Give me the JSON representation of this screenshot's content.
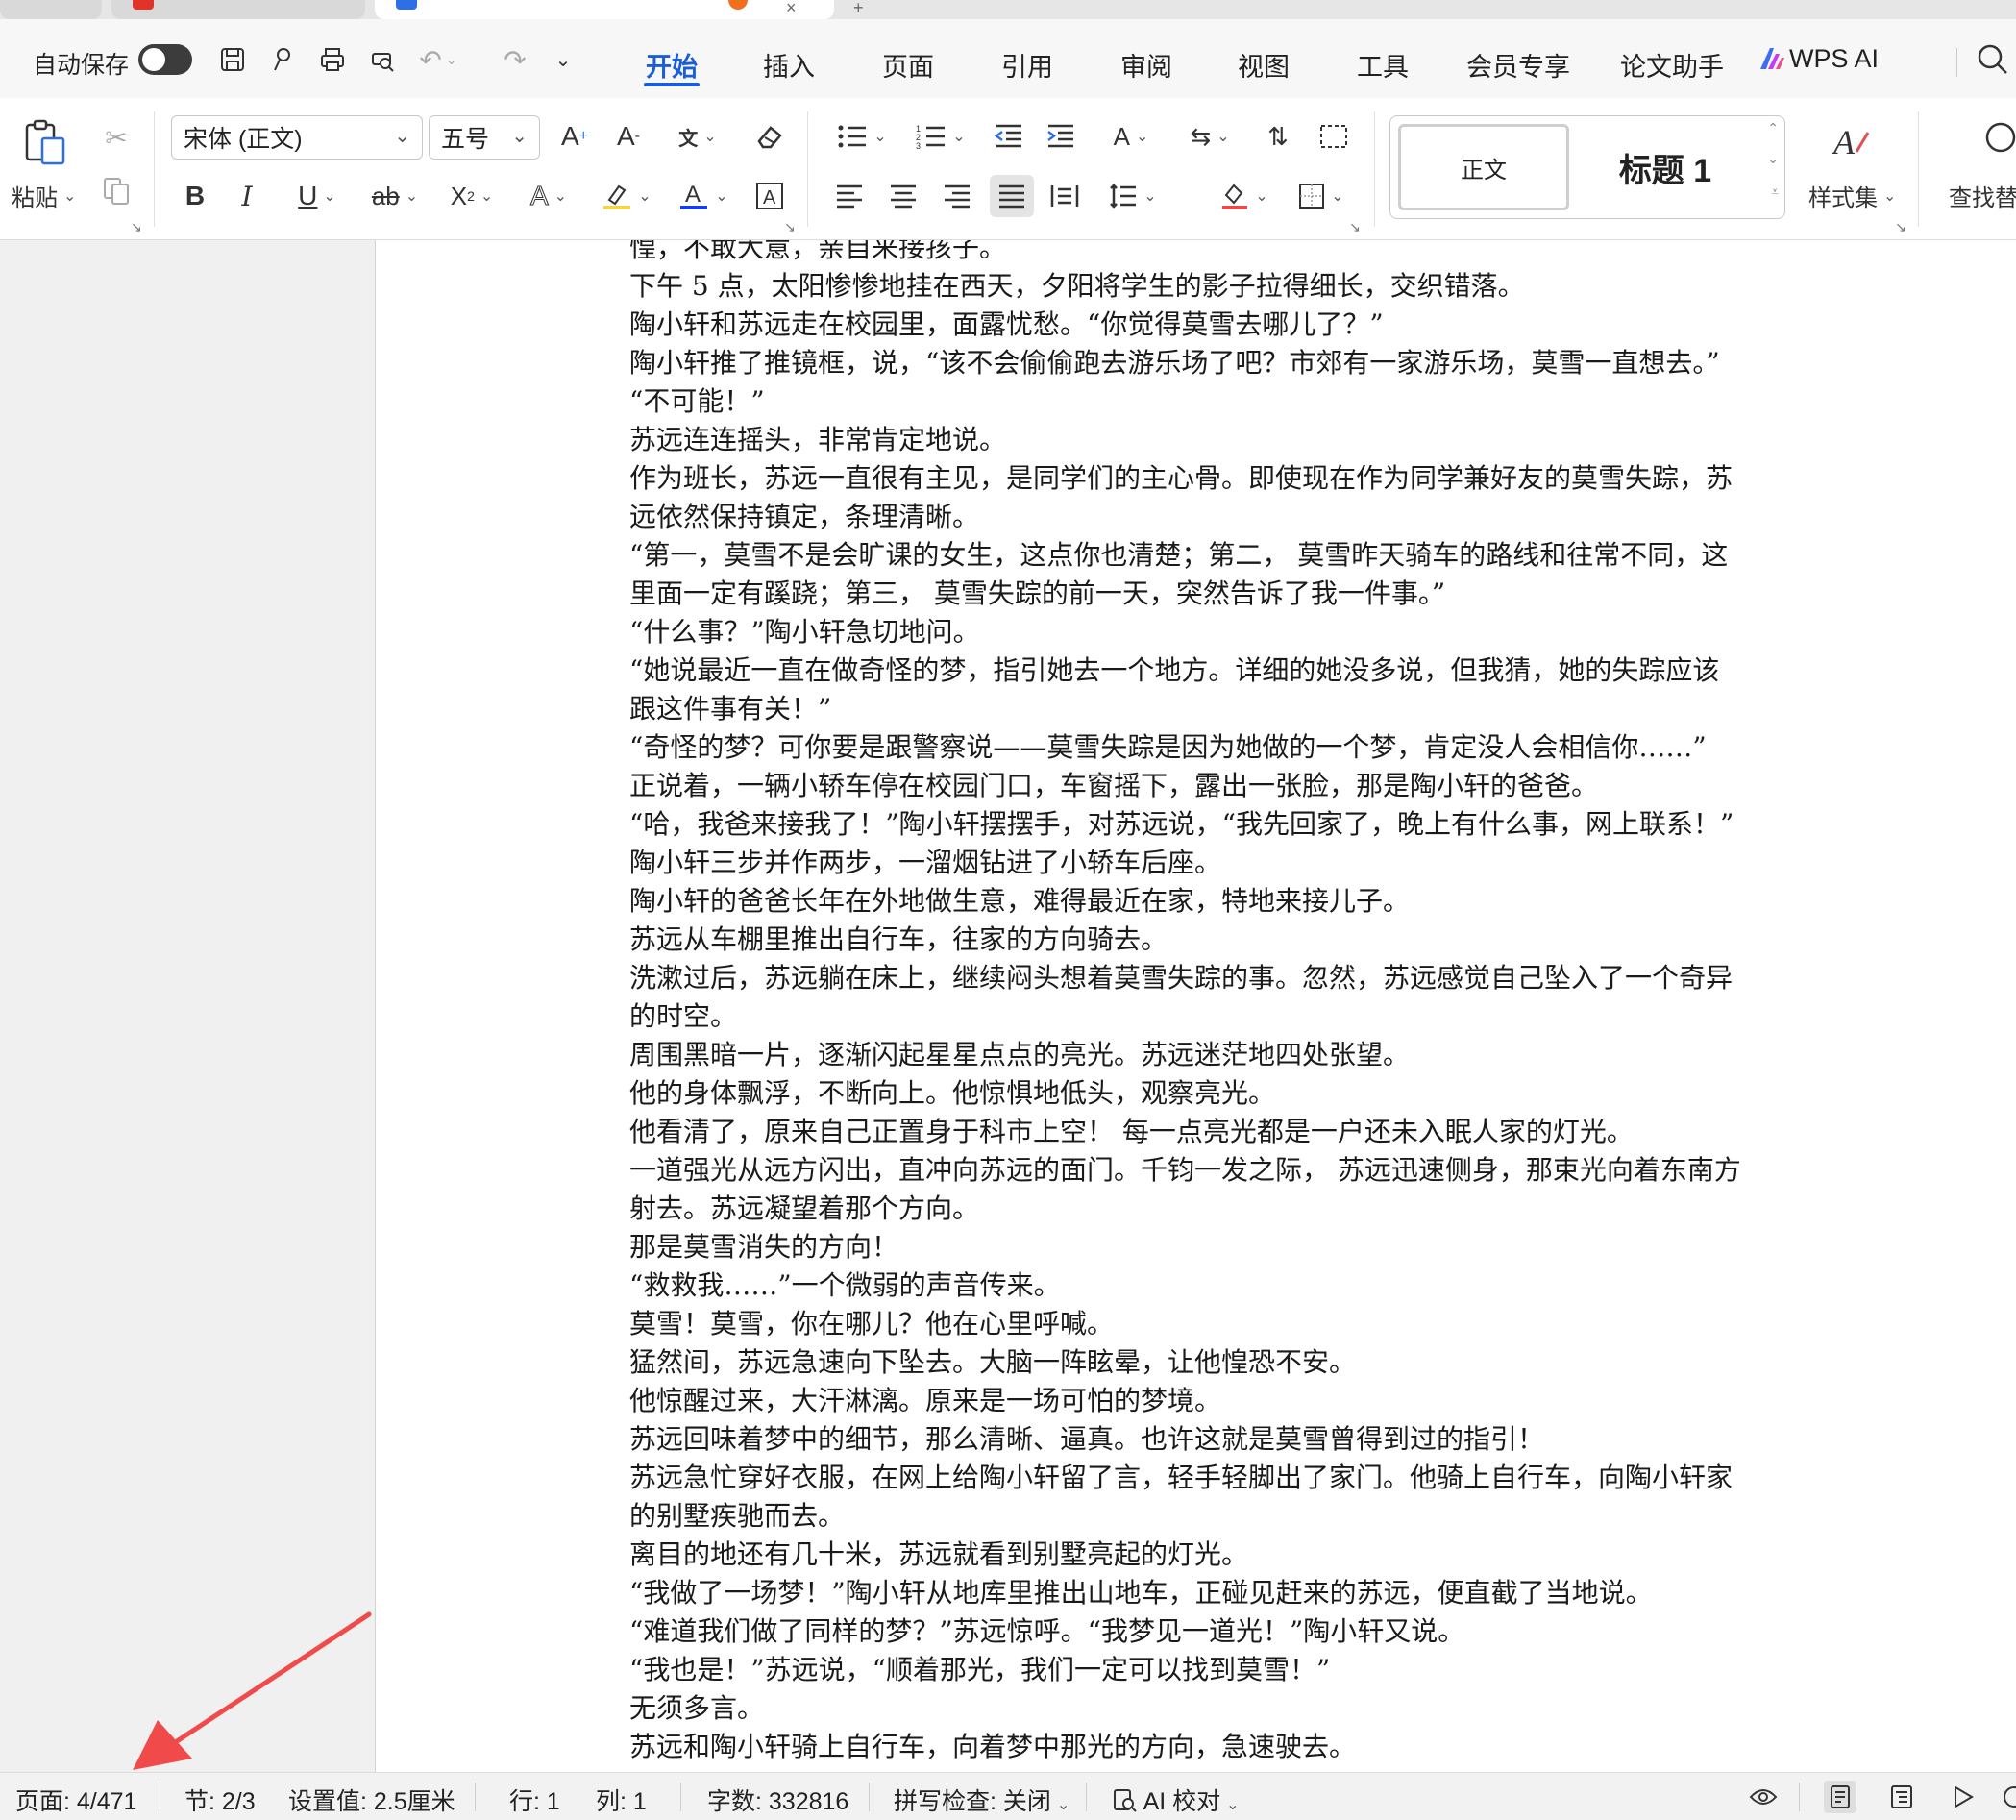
{
  "menu": {
    "autosave_label": "自动保存",
    "tabs": [
      "开始",
      "插入",
      "页面",
      "引用",
      "审阅",
      "视图",
      "工具",
      "会员专享",
      "论文助手"
    ],
    "active_tab": "开始",
    "wps_ai": "WPS AI"
  },
  "ribbon": {
    "paste_label": "粘贴",
    "font_name": "宋体 (正文)",
    "font_size": "五号",
    "styles": {
      "normal": "正文",
      "heading1": "标题 1"
    },
    "style_set_label": "样式集",
    "find_replace_label": "查找替"
  },
  "document": {
    "paragraphs": [
      "惶，不敢大意，亲自来接孩子。",
      "下午 5 点，太阳惨惨地挂在西天，夕阳将学生的影子拉得细长，交织错落。",
      "陶小轩和苏远走在校园里，面露忧愁。“你觉得莫雪去哪儿了？”",
      "陶小轩推了推镜框，说，“该不会偷偷跑去游乐场了吧？市郊有一家游乐场，莫雪一直想去。”",
      "“不可能！”",
      "苏远连连摇头，非常肯定地说。",
      "作为班长，苏远一直很有主见，是同学们的主心骨。即使现在作为同学兼好友的莫雪失踪，苏",
      "远依然保持镇定，条理清晰。",
      "“第一，莫雪不是会旷课的女生，这点你也清楚；第二， 莫雪昨天骑车的路线和往常不同，这",
      "里面一定有蹊跷；第三， 莫雪失踪的前一天，突然告诉了我一件事。”",
      "“什么事？”陶小轩急切地问。",
      "“她说最近一直在做奇怪的梦，指引她去一个地方。详细的她没多说，但我猜，她的失踪应该",
      "跟这件事有关！”",
      "“奇怪的梦？可你要是跟警察说——莫雪失踪是因为她做的一个梦，肯定没人会相信你……”",
      "正说着，一辆小轿车停在校园门口，车窗摇下，露出一张脸，那是陶小轩的爸爸。",
      "“哈，我爸来接我了！”陶小轩摆摆手，对苏远说，“我先回家了，晚上有什么事，网上联系！”",
      "陶小轩三步并作两步，一溜烟钻进了小轿车后座。",
      "陶小轩的爸爸长年在外地做生意，难得最近在家，特地来接儿子。",
      "苏远从车棚里推出自行车，往家的方向骑去。",
      "洗漱过后，苏远躺在床上，继续闷头想着莫雪失踪的事。忽然，苏远感觉自己坠入了一个奇异",
      "的时空。",
      "周围黑暗一片，逐渐闪起星星点点的亮光。苏远迷茫地四处张望。",
      "他的身体飘浮，不断向上。他惊惧地低头，观察亮光。",
      "他看清了，原来自己正置身于科市上空！ 每一点亮光都是一户还未入眠人家的灯光。",
      "一道强光从远方闪出，直冲向苏远的面门。千钧一发之际， 苏远迅速侧身，那束光向着东南方",
      "射去。苏远凝望着那个方向。",
      "那是莫雪消失的方向！",
      "“救救我……”一个微弱的声音传来。",
      "莫雪！莫雪，你在哪儿？他在心里呼喊。",
      "猛然间，苏远急速向下坠去。大脑一阵眩晕，让他惶恐不安。",
      "他惊醒过来，大汗淋漓。原来是一场可怕的梦境。",
      "苏远回味着梦中的细节，那么清晰、逼真。也许这就是莫雪曾得到过的指引！",
      "苏远急忙穿好衣服，在网上给陶小轩留了言，轻手轻脚出了家门。他骑上自行车，向陶小轩家",
      "的别墅疾驰而去。",
      "离目的地还有几十米，苏远就看到别墅亮起的灯光。",
      "“我做了一场梦！”陶小轩从地库里推出山地车，正碰见赶来的苏远，便直截了当地说。",
      "“难道我们做了同样的梦？”苏远惊呼。“我梦见一道光！”陶小轩又说。",
      "“我也是！”苏远说，“顺着那光，我们一定可以找到莫雪！”",
      "无须多言。",
      "苏远和陶小轩骑上自行车，向着梦中那光的方向，急速驶去。"
    ]
  },
  "status": {
    "page": "页面: 4/471",
    "section": "节: 2/3",
    "setting": "设置值: 2.5厘米",
    "row": "行: 1",
    "col": "列: 1",
    "word_count": "字数: 332816",
    "spell_check": "拼写检查: 关闭",
    "ai_proof": "AI 校对"
  },
  "colors": {
    "accent": "#1a5fd8",
    "annotation_arrow": "#f04a4a"
  }
}
